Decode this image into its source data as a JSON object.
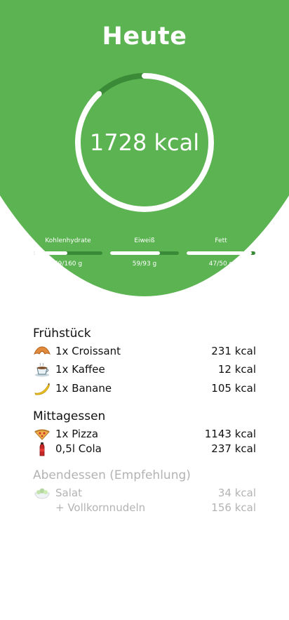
{
  "header": {
    "title": "Heute",
    "total_kcal": "1728 kcal",
    "calorie_progress": 0.88,
    "colors": {
      "background": "#5bb351",
      "ring": "#ffffff",
      "ring_track": "#3a8a37"
    }
  },
  "macros": [
    {
      "name": "Kohlenhydrate",
      "value": "79/160 g",
      "progress": 0.49
    },
    {
      "name": "Eiweiß",
      "value": "59/93 g",
      "progress": 0.72
    },
    {
      "name": "Fett",
      "value": "47/50 g",
      "progress": 0.95
    }
  ],
  "meals": {
    "breakfast": {
      "title": "Frühstück",
      "items": [
        {
          "icon": "croissant-icon",
          "name": "1x Croissant",
          "kcal": "231 kcal"
        },
        {
          "icon": "coffee-icon",
          "name": "1x Kaffee",
          "kcal": "12 kcal"
        },
        {
          "icon": "banana-icon",
          "name": "1x Banane",
          "kcal": "105 kcal"
        }
      ]
    },
    "lunch": {
      "title": "Mittagessen",
      "items": [
        {
          "icon": "pizza-icon",
          "name": "1x Pizza",
          "kcal": "1143 kcal"
        },
        {
          "icon": "cola-icon",
          "name": "0,5l Cola",
          "kcal": "237 kcal"
        }
      ]
    },
    "dinner": {
      "title": "Abendessen (Empfehlung)",
      "items": [
        {
          "icon": "salad-icon",
          "name": "Salat",
          "kcal": "34 kcal"
        },
        {
          "icon": "",
          "name": "+ Vollkornnudeln",
          "kcal": "156 kcal"
        }
      ]
    }
  }
}
